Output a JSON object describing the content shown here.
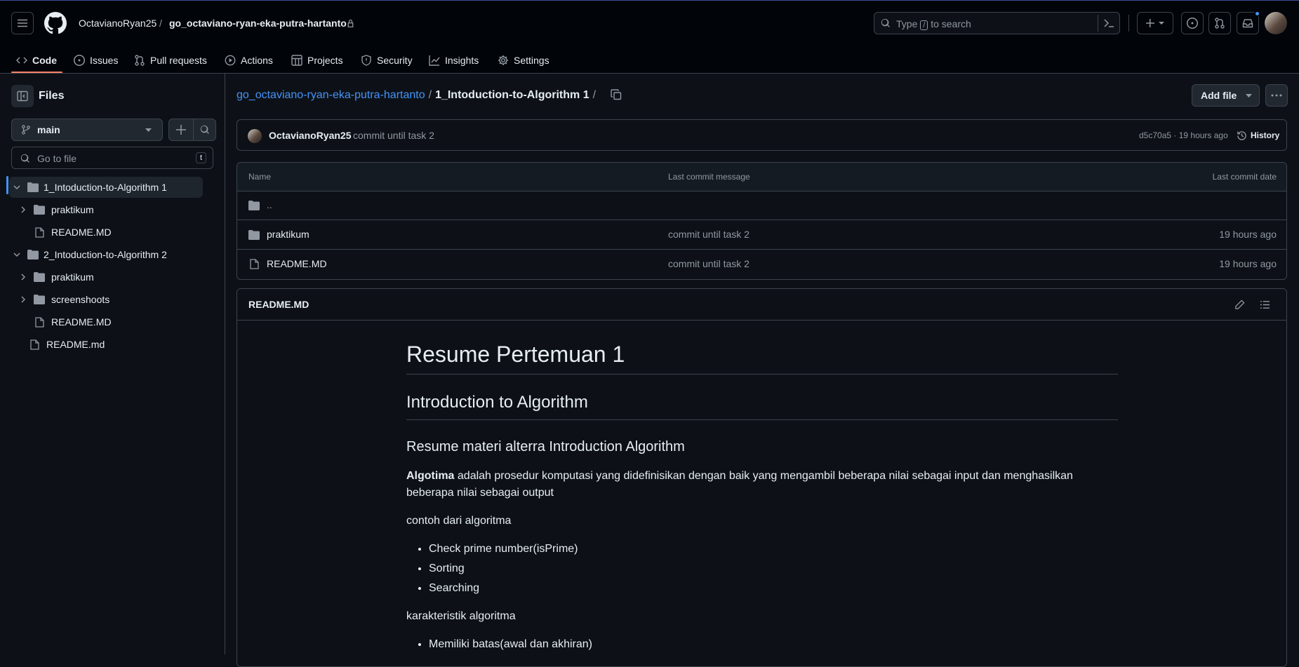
{
  "header": {
    "owner": "OctavianoRyan25",
    "separator": "/",
    "repo": "go_octaviano-ryan-eka-putra-hartanto",
    "search_prefix": "Type",
    "search_key": "/",
    "search_suffix": "to search"
  },
  "nav": {
    "items": [
      {
        "label": "Code",
        "icon": "code-icon"
      },
      {
        "label": "Issues",
        "icon": "issue-icon"
      },
      {
        "label": "Pull requests",
        "icon": "pull-request-icon"
      },
      {
        "label": "Actions",
        "icon": "actions-icon"
      },
      {
        "label": "Projects",
        "icon": "projects-icon"
      },
      {
        "label": "Security",
        "icon": "shield-icon"
      },
      {
        "label": "Insights",
        "icon": "graph-icon"
      },
      {
        "label": "Settings",
        "icon": "gear-icon"
      }
    ]
  },
  "sidebar": {
    "title": "Files",
    "branch": "main",
    "goto_placeholder": "Go to file",
    "goto_key": "t",
    "tree": [
      {
        "label": "1_Intoduction-to-Algorithm 1",
        "type": "folder-open"
      },
      {
        "label": "praktikum",
        "type": "folder"
      },
      {
        "label": "README.MD",
        "type": "file"
      },
      {
        "label": "2_Intoduction-to-Algorithm 2",
        "type": "folder-open"
      },
      {
        "label": "praktikum",
        "type": "folder"
      },
      {
        "label": "screenshoots",
        "type": "folder"
      },
      {
        "label": "README.MD",
        "type": "file"
      },
      {
        "label": "README.md",
        "type": "file"
      }
    ]
  },
  "breadcrumb": {
    "repo_link": "go_octaviano-ryan-eka-putra-hartanto",
    "sep1": "/",
    "current": "1_Intoduction-to-Algorithm 1",
    "sep2": "/"
  },
  "toolbar": {
    "add_file": "Add file"
  },
  "commit": {
    "author": "OctavianoRyan25",
    "message": "commit until task 2",
    "hash_time": "d5c70a5 · 19 hours ago",
    "history": "History"
  },
  "table": {
    "headers": [
      "Name",
      "Last commit message",
      "Last commit date"
    ],
    "parent": "..",
    "rows": [
      {
        "name": "praktikum",
        "message": "commit until task 2",
        "date": "19 hours ago"
      },
      {
        "name": "README.MD",
        "message": "commit until task 2",
        "date": "19 hours ago"
      }
    ]
  },
  "readme": {
    "filename": "README.MD",
    "h1": "Resume Pertemuan 1",
    "h2": "Introduction to Algorithm",
    "h3": "Resume materi alterra Introduction Algorithm",
    "p1_bold": "Algotima",
    "p1_rest": " adalah prosedur komputasi yang didefinisikan dengan baik yang mengambil beberapa nilai sebagai input dan menghasilkan beberapa nilai sebagai output",
    "p2": "contoh dari algoritma",
    "list1": [
      "Check prime number(isPrime)",
      "Sorting",
      "Searching"
    ],
    "p3": "karakteristik algoritma",
    "list2": [
      "Memiliki batas(awal dan akhiran)"
    ]
  },
  "colors": {
    "accent_underline": "#f78166",
    "link": "#4493f8",
    "notification_dot": "#4493f8"
  }
}
